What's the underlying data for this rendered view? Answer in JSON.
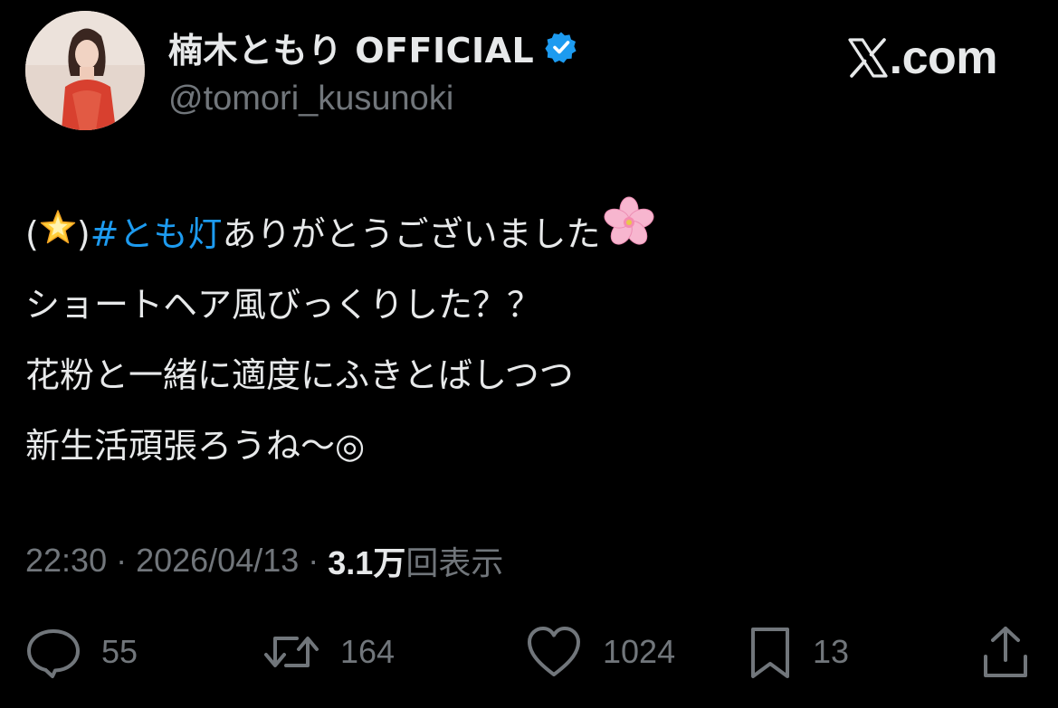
{
  "header": {
    "display_name": "楠木ともり OFFICIAL",
    "handle": "@tomori_kusunoki",
    "avatar_icon": "profile-photo",
    "verified_icon": "verified-badge-icon",
    "site_logo": "X.com",
    "site_logo_text": ".com",
    "colors": {
      "background": "#000000",
      "text": "#e7e9ea",
      "muted": "#71767b",
      "accent": "#1d9bf0"
    }
  },
  "tweet": {
    "line1_paren_open": "(",
    "line1_emoji": "glowing-star-icon",
    "line1_paren_close": ")",
    "line1_hashtag": "#とも灯",
    "line1_text": " ありがとうございました",
    "line1_trailing_emoji": "cherry-blossom-icon",
    "line2": "ショートヘア風びっくりした？？",
    "line3": "花粉と一緒に適度にふきとばしつつ",
    "line4": "新生活頑張ろうね〜◎"
  },
  "meta": {
    "time": "22:30",
    "separator": "·",
    "date": "2026/04/13",
    "views_count": "3.1万",
    "views_label": "回表示"
  },
  "actions": {
    "replies": {
      "icon": "reply-icon",
      "count": "55"
    },
    "retweets": {
      "icon": "retweet-icon",
      "count": "164"
    },
    "likes": {
      "icon": "heart-icon",
      "count": "1024"
    },
    "bookmarks": {
      "icon": "bookmark-icon",
      "count": "13"
    },
    "share": {
      "icon": "share-icon"
    }
  }
}
